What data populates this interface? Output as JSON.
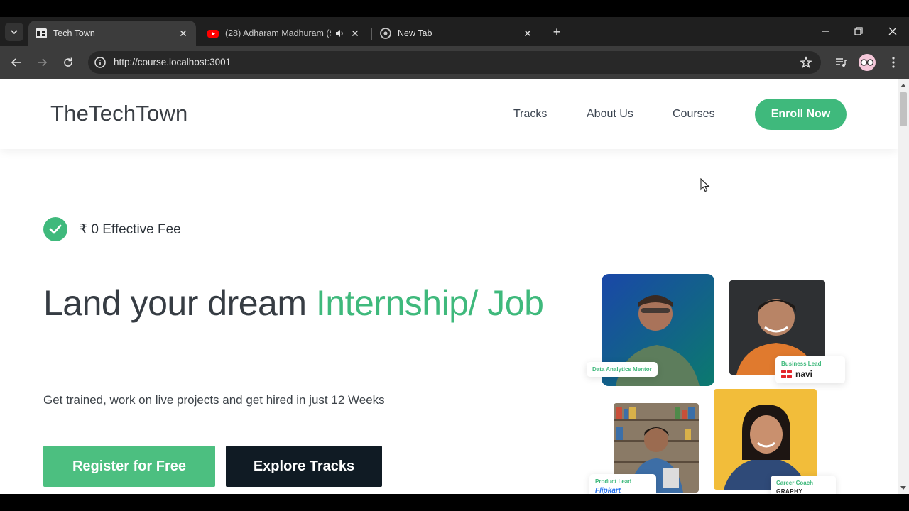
{
  "browser": {
    "tabs": [
      {
        "title": "Tech Town",
        "active": true
      },
      {
        "title": "(28) Adharam Madhuram (S",
        "active": false
      },
      {
        "title": "New Tab",
        "active": false
      }
    ],
    "address": "http://course.localhost:3001"
  },
  "site": {
    "logo": "TheTechTown",
    "nav": {
      "tracks": "Tracks",
      "about": "About Us",
      "courses": "Courses",
      "enroll": "Enroll Now"
    },
    "hero": {
      "fee": "₹ 0 Effective Fee",
      "headline_plain": "Land your dream ",
      "headline_accent": "Internship/ Job",
      "subline": "Get trained, work on live projects and get hired in just 12 Weeks",
      "register": "Register for Free",
      "explore": "Explore Tracks"
    },
    "mentors": [
      {
        "role": "Data Analytics Mentor",
        "company": ""
      },
      {
        "role": "Business Lead",
        "company": "navi"
      },
      {
        "role": "Product Lead",
        "company": "Flipkart"
      },
      {
        "role": "Career Coach",
        "company": "GRAPHY"
      }
    ]
  },
  "colors": {
    "accent": "#3fb97c",
    "dark_button": "#101b24"
  }
}
